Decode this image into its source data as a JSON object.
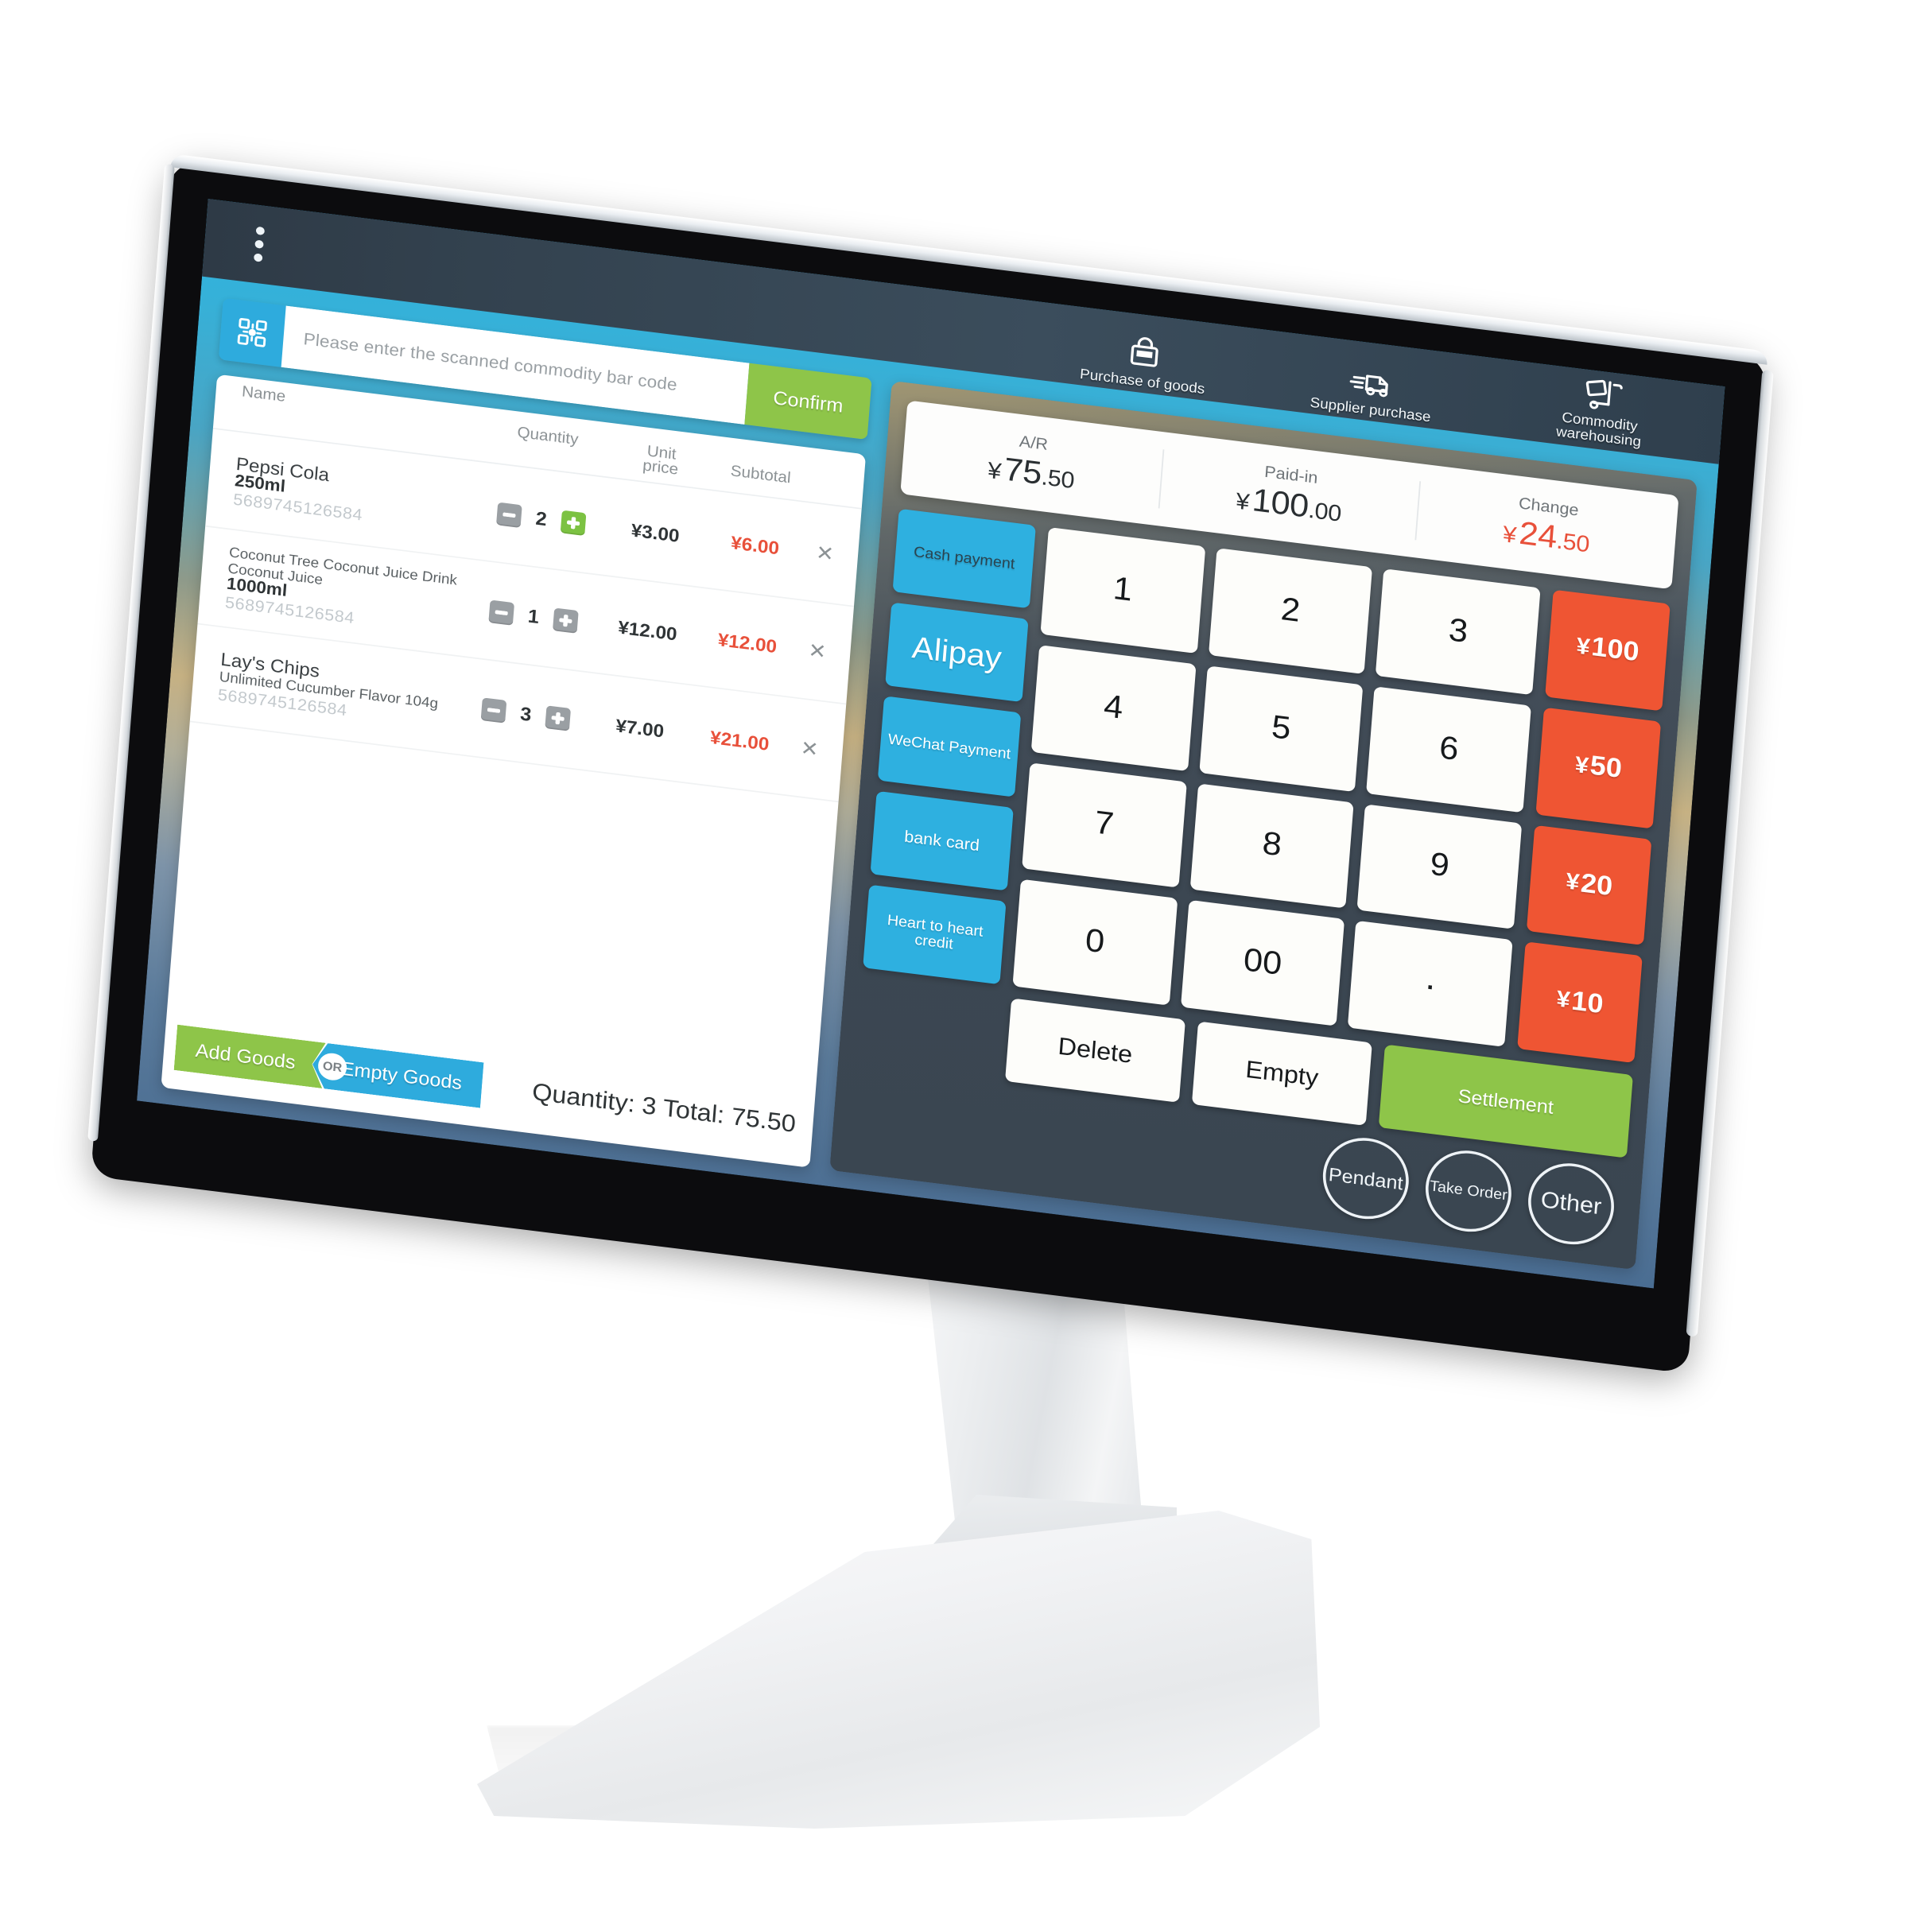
{
  "topbar": {
    "menu_icon": "three-dots-vertical-icon",
    "nav": [
      {
        "label": "Purchase of goods",
        "icon": "shopping-bag-icon"
      },
      {
        "label": "Supplier purchase",
        "icon": "delivery-truck-icon"
      },
      {
        "label": "Commodity warehousing",
        "label_line1": "Commodity",
        "label_line2": "warehousing",
        "icon": "hand-truck-icon"
      }
    ]
  },
  "scan": {
    "icon": "qr-scan-icon",
    "placeholder": "Please enter the scanned commodity bar code",
    "value": "",
    "confirm_label": "Confirm"
  },
  "cart": {
    "headers": {
      "name": "Name",
      "quantity": "Quantity",
      "unit_price_line1": "Unit",
      "unit_price_line2": "price",
      "subtotal": "Subtotal"
    },
    "rows": [
      {
        "name": "Pepsi Cola",
        "sub_name": "",
        "spec": "250ml",
        "code": "5689745126584",
        "quantity": "2",
        "unit_price": "¥3.00",
        "subtotal": "¥6.00",
        "plus_active": true,
        "delete_icon": "close-icon"
      },
      {
        "name": "Coconut Tree Coconut Juice Drink",
        "sub_name": "Coconut Juice",
        "spec": "1000ml",
        "code": "5689745126584",
        "quantity": "1",
        "unit_price": "¥12.00",
        "subtotal": "¥12.00",
        "plus_active": false,
        "delete_icon": "close-icon"
      },
      {
        "name": "Lay's Chips",
        "sub_name": "Unlimited Cucumber Flavor 104g",
        "spec": "",
        "code": "5689745126584",
        "quantity": "3",
        "unit_price": "¥7.00",
        "subtotal": "¥21.00",
        "plus_active": false,
        "delete_icon": "close-icon"
      }
    ],
    "footer": {
      "add_goods_label": "Add Goods",
      "or_label": "OR",
      "empty_goods_label": "Empty Goods",
      "total_text": "Quantity: 3 Total: 75.50"
    }
  },
  "amounts": [
    {
      "label": "A/R",
      "currency": "¥",
      "int": "75",
      "dec": ".50",
      "accent": false
    },
    {
      "label": "Paid-in",
      "currency": "¥",
      "int": "100",
      "dec": ".00",
      "accent": false
    },
    {
      "label": "Change",
      "currency": "¥",
      "int": "24",
      "dec": ".50",
      "accent": true
    }
  ],
  "payment_methods": [
    {
      "label": "Cash payment",
      "size": "tiny",
      "dark": true
    },
    {
      "label": "Alipay",
      "size": "big",
      "dark": false
    },
    {
      "label": "WeChat Payment",
      "size": "tiny",
      "dark": false
    },
    {
      "label": "bank card",
      "size": "std",
      "dark": false
    },
    {
      "label": "Heart to heart credit",
      "size": "tiny",
      "dark": false
    }
  ],
  "keypad": [
    "1",
    "2",
    "3",
    "4",
    "5",
    "6",
    "7",
    "8",
    "9",
    "0",
    "00",
    "."
  ],
  "quick_amounts": [
    {
      "currency": "¥",
      "value": "100"
    },
    {
      "currency": "¥",
      "value": "50"
    },
    {
      "currency": "¥",
      "value": "20"
    },
    {
      "currency": "¥",
      "value": "10"
    }
  ],
  "actions": {
    "delete_label": "Delete",
    "empty_label": "Empty",
    "settlement_label": "Settlement"
  },
  "circles": [
    {
      "label": "Pendant"
    },
    {
      "label": "Take Order"
    },
    {
      "label": "Other"
    }
  ],
  "colors": {
    "accent_blue": "#2eb0e0",
    "accent_green": "#8ec549",
    "accent_red": "#ef5533",
    "amount_red": "#e8503a",
    "panel_dark": "#3c4752",
    "topbar": "#33424f"
  }
}
